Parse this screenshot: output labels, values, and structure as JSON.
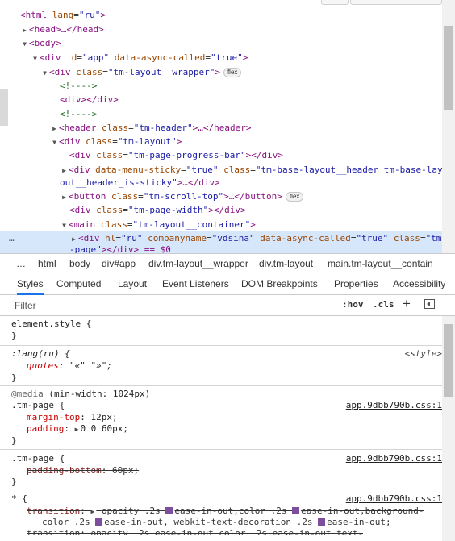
{
  "elements_tree": {
    "lines": [
      {
        "pre": "<html ",
        "attr": "lang",
        "val": "\"ru\"",
        "post": ">"
      },
      {
        "text": "<head>…</head>"
      },
      {
        "text": "<body>"
      },
      {
        "pre": "<div ",
        "attr": "id",
        "val": "\"app\"",
        "attr2": "data-async-called",
        "val2": "\"true\"",
        "post": ">"
      },
      {
        "pre": "<div ",
        "attr": "class",
        "val": "\"tm-layout__wrapper\"",
        "post": ">",
        "badge": "flex"
      },
      {
        "text": "<!---->"
      },
      {
        "text": "<div></div>"
      },
      {
        "text": "<!---->"
      },
      {
        "pre": "<header ",
        "attr": "class",
        "val": "\"tm-header\"",
        "post": ">…</header>"
      },
      {
        "pre": "<div ",
        "attr": "class",
        "val": "\"tm-layout\"",
        "post": ">"
      },
      {
        "pre": "<div ",
        "attr": "class",
        "val": "\"tm-page-progress-bar\"",
        "post": "></div>"
      },
      {
        "pre": "<div ",
        "attr": "data-menu-sticky",
        "val": "\"true\"",
        "attr2": "class",
        "val2": "\"tm-base-layout__header tm-base-lay"
      },
      {
        "val": "out__header_is-sticky\"",
        "post": ">…</div>"
      },
      {
        "pre": "<button ",
        "attr": "class",
        "val": "\"tm-scroll-top\"",
        "post": ">…</button>",
        "badge": "flex"
      },
      {
        "pre": "<div ",
        "attr": "class",
        "val": "\"tm-page-width\"",
        "post": "></div>"
      },
      {
        "pre": "<main ",
        "attr": "class",
        "val": "\"tm-layout__container\"",
        "post": ">"
      },
      {
        "pre": "<div ",
        "attr": "hl",
        "val": "\"ru\"",
        "attr2": "companyname",
        "val2": "\"vdsina\"",
        "attr3": "data-async-called",
        "val3": "\"true\"",
        "attr4": "class",
        "val4": "\"tm"
      },
      {
        "val": "-page\"",
        "post": "></div> == $0"
      }
    ],
    "dots": "…"
  },
  "breadcrumb": {
    "items": [
      "…",
      "html",
      "body",
      "div#app",
      "div.tm-layout__wrapper",
      "div.tm-layout",
      "main.tm-layout__contain"
    ]
  },
  "tabs": [
    "Styles",
    "Computed",
    "Layout",
    "Event Listeners",
    "DOM Breakpoints",
    "Properties",
    "Accessibility"
  ],
  "filter": {
    "placeholder": "Filter",
    "hov": ":hov",
    "cls": ".cls",
    "plus": "+"
  },
  "styles": {
    "element_style": {
      "selector": "element.style {",
      "close": "}"
    },
    "lang_rule": {
      "selector": ":lang(ru) {",
      "source": "<style>",
      "prop": "quotes",
      "value": "\"«\" \"»\";",
      "close": "}"
    },
    "media_rule": {
      "media_kw": "@media",
      "media_q": "(min-width: 1024px)",
      "selector": ".tm-page {",
      "source": "app.9dbb790b.css:1",
      "prop1": "margin-top",
      "val1": "12px;",
      "prop2": "padding",
      "val2": "0 0 60px;",
      "close": "}"
    },
    "page_rule": {
      "selector": ".tm-page {",
      "source": "app.9dbb790b.css:1",
      "prop": "padding-bottom",
      "value": "60px;",
      "close": "}"
    },
    "star_rule": {
      "selector": "* {",
      "source": "app.9dbb790b.css:1",
      "prop": "transition",
      "value_a": "opacity .2s",
      "value_b": "ease-in-out,color .2s",
      "value_c": "ease-in-out,background-",
      "value_d": "color .2s",
      "value_e": "ease-in-out, webkit-text-decoration .2s",
      "value_f": "ease-in-out;",
      "next": "transition: opacity .2s  ease-in-out,color .2s  ease-in-out,text-"
    }
  }
}
